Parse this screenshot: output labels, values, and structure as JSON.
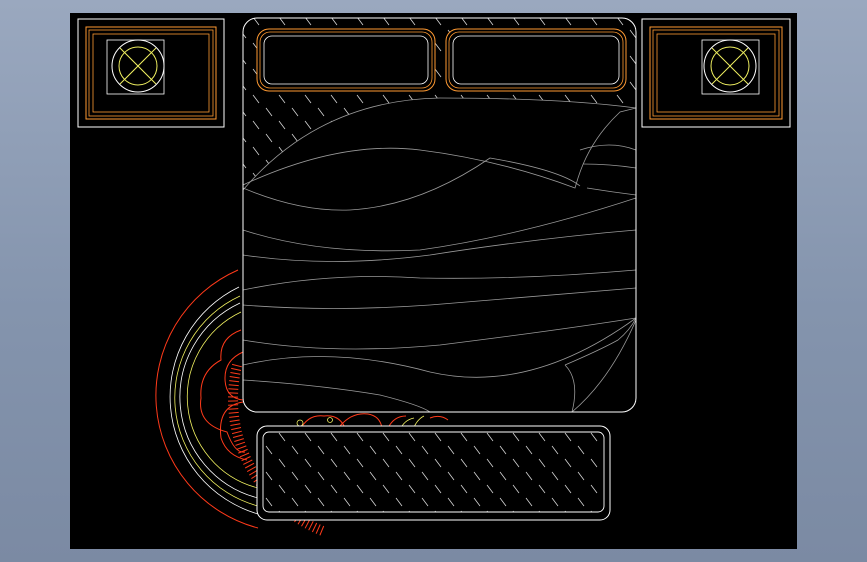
{
  "viewport": {
    "background_gradient": [
      "#9aa8bf",
      "#7b8aa3"
    ],
    "canvas_color": "#000000"
  },
  "colors": {
    "outline": "#ffffff",
    "orange": "#ff9a32",
    "red": "#ff3a1a",
    "yellow": "#f0f060",
    "grey": "#8a8a8a"
  },
  "drawing": {
    "objects": [
      "nightstand-left",
      "lamp-left",
      "bed-frame",
      "pillow-left",
      "pillow-right",
      "duvet",
      "nightstand-right",
      "lamp-right",
      "round-rug",
      "bench"
    ]
  }
}
